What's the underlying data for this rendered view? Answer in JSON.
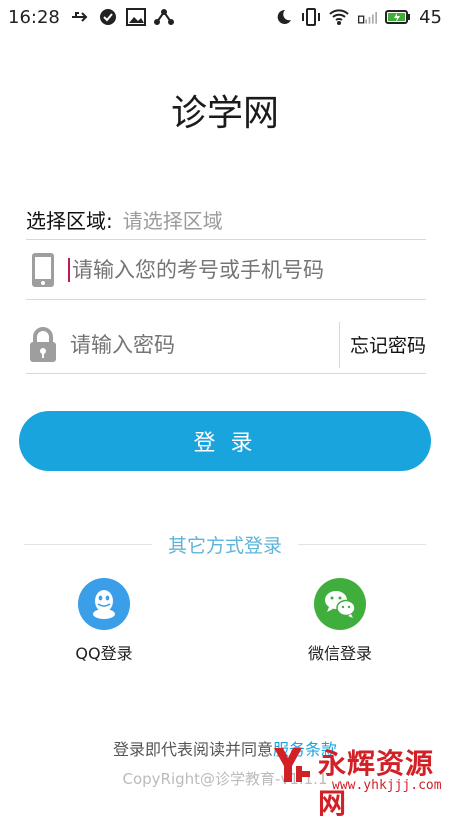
{
  "status_bar": {
    "time": "16:28",
    "battery": "45",
    "icons_left": [
      "usb-icon",
      "check-circle-icon",
      "image-icon",
      "share-icon"
    ],
    "icons_right": [
      "moon-icon",
      "vibrate-icon",
      "wifi-icon",
      "signal-icon",
      "battery-icon"
    ]
  },
  "app": {
    "title": "诊学网"
  },
  "form": {
    "region_label": "选择区域:",
    "region_placeholder": "请选择区域",
    "phone_placeholder": "请输入您的考号或手机号码",
    "password_placeholder": "请输入密码",
    "forgot_label": "忘记密码",
    "login_label": "登 录"
  },
  "other_login": {
    "title": "其它方式登录",
    "qq_label": "QQ登录",
    "wechat_label": "微信登录"
  },
  "footer": {
    "terms_prefix": "登录即代表阅读并同意",
    "terms_link": "服务条款",
    "copyright": "CopyRight@诊学教育-v1.1.1"
  },
  "watermark": {
    "text": "永辉资源网",
    "url": "www.yhkjjj.com"
  },
  "colors": {
    "accent": "#1aa4de",
    "qq": "#3a9ee8",
    "wechat": "#3fae3c",
    "watermark": "#d22027"
  }
}
